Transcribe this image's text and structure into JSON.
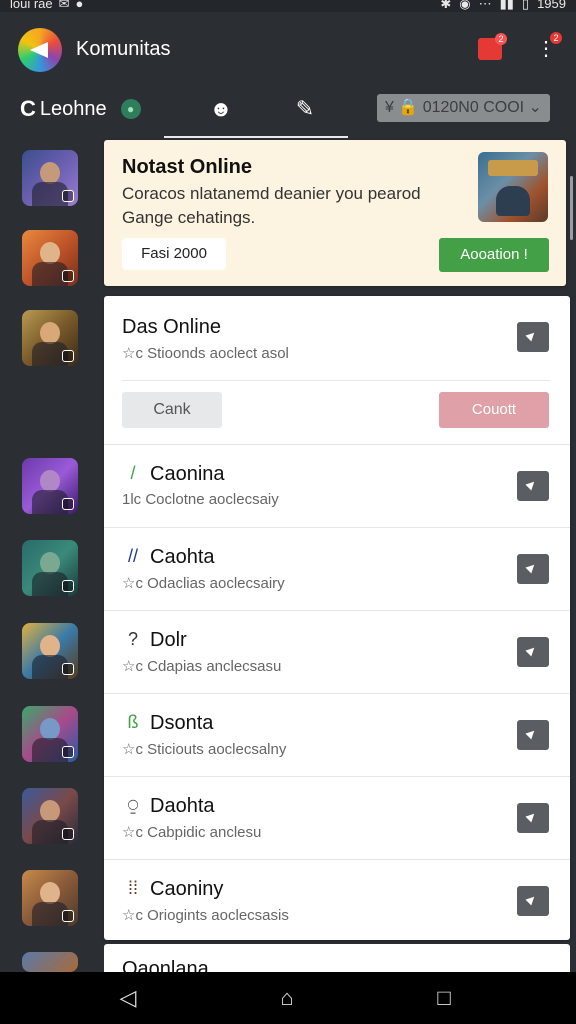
{
  "status_bar": {
    "left_text": "loui rae",
    "right_text": "1959"
  },
  "app": {
    "title": "Komunitas",
    "mail_badge": "2",
    "menu_badge": "2"
  },
  "tabs": {
    "home_label": "Leohne",
    "home_letter": "C"
  },
  "search": {
    "text": "¥ 🔒 0120N0 COOI ⌄"
  },
  "banner": {
    "title": "Notast Online",
    "description": "Coracos nlatanemd deanier you pearod Gange cehatings.",
    "pill_label": "Fasi 2000",
    "action_label": "Aooation !"
  },
  "card": {
    "name": "Das Online",
    "subtitle": "☆c Stioonds aoclect asol",
    "cancel_label": "Cank",
    "confirm_label": "Couott"
  },
  "list": [
    {
      "icon": "/",
      "icon_color": "#43a047",
      "name": "Caonina",
      "subtitle": "1lc Coclotne aoclecsaiy"
    },
    {
      "icon": "//",
      "icon_color": "#1e3a8a",
      "name": "Caohta",
      "subtitle": "☆c Odaclias aoclecsairy"
    },
    {
      "icon": "?",
      "icon_color": "#333333",
      "name": "Dolr",
      "subtitle": "☆c Cdapias anclecsasu"
    },
    {
      "icon": "ß",
      "icon_color": "#43a047",
      "name": "Dsonta",
      "subtitle": "☆c Sticiouts aoclecsalny"
    },
    {
      "icon": "⍜",
      "icon_color": "#333333",
      "name": "Daohta",
      "subtitle": "☆c Cabpidic anclesu"
    },
    {
      "icon": "⁞⁞",
      "icon_color": "#6b3a2a",
      "name": "Caoniny",
      "subtitle": "☆c Oriogints aoclecsasis"
    }
  ],
  "partial_item": {
    "name": "Qaonlana"
  },
  "colors": {
    "appbar": "#2b2f34",
    "banner_bg": "#fdf3e1",
    "accent_green": "#43a047",
    "accent_pink": "#e0a0a8"
  }
}
